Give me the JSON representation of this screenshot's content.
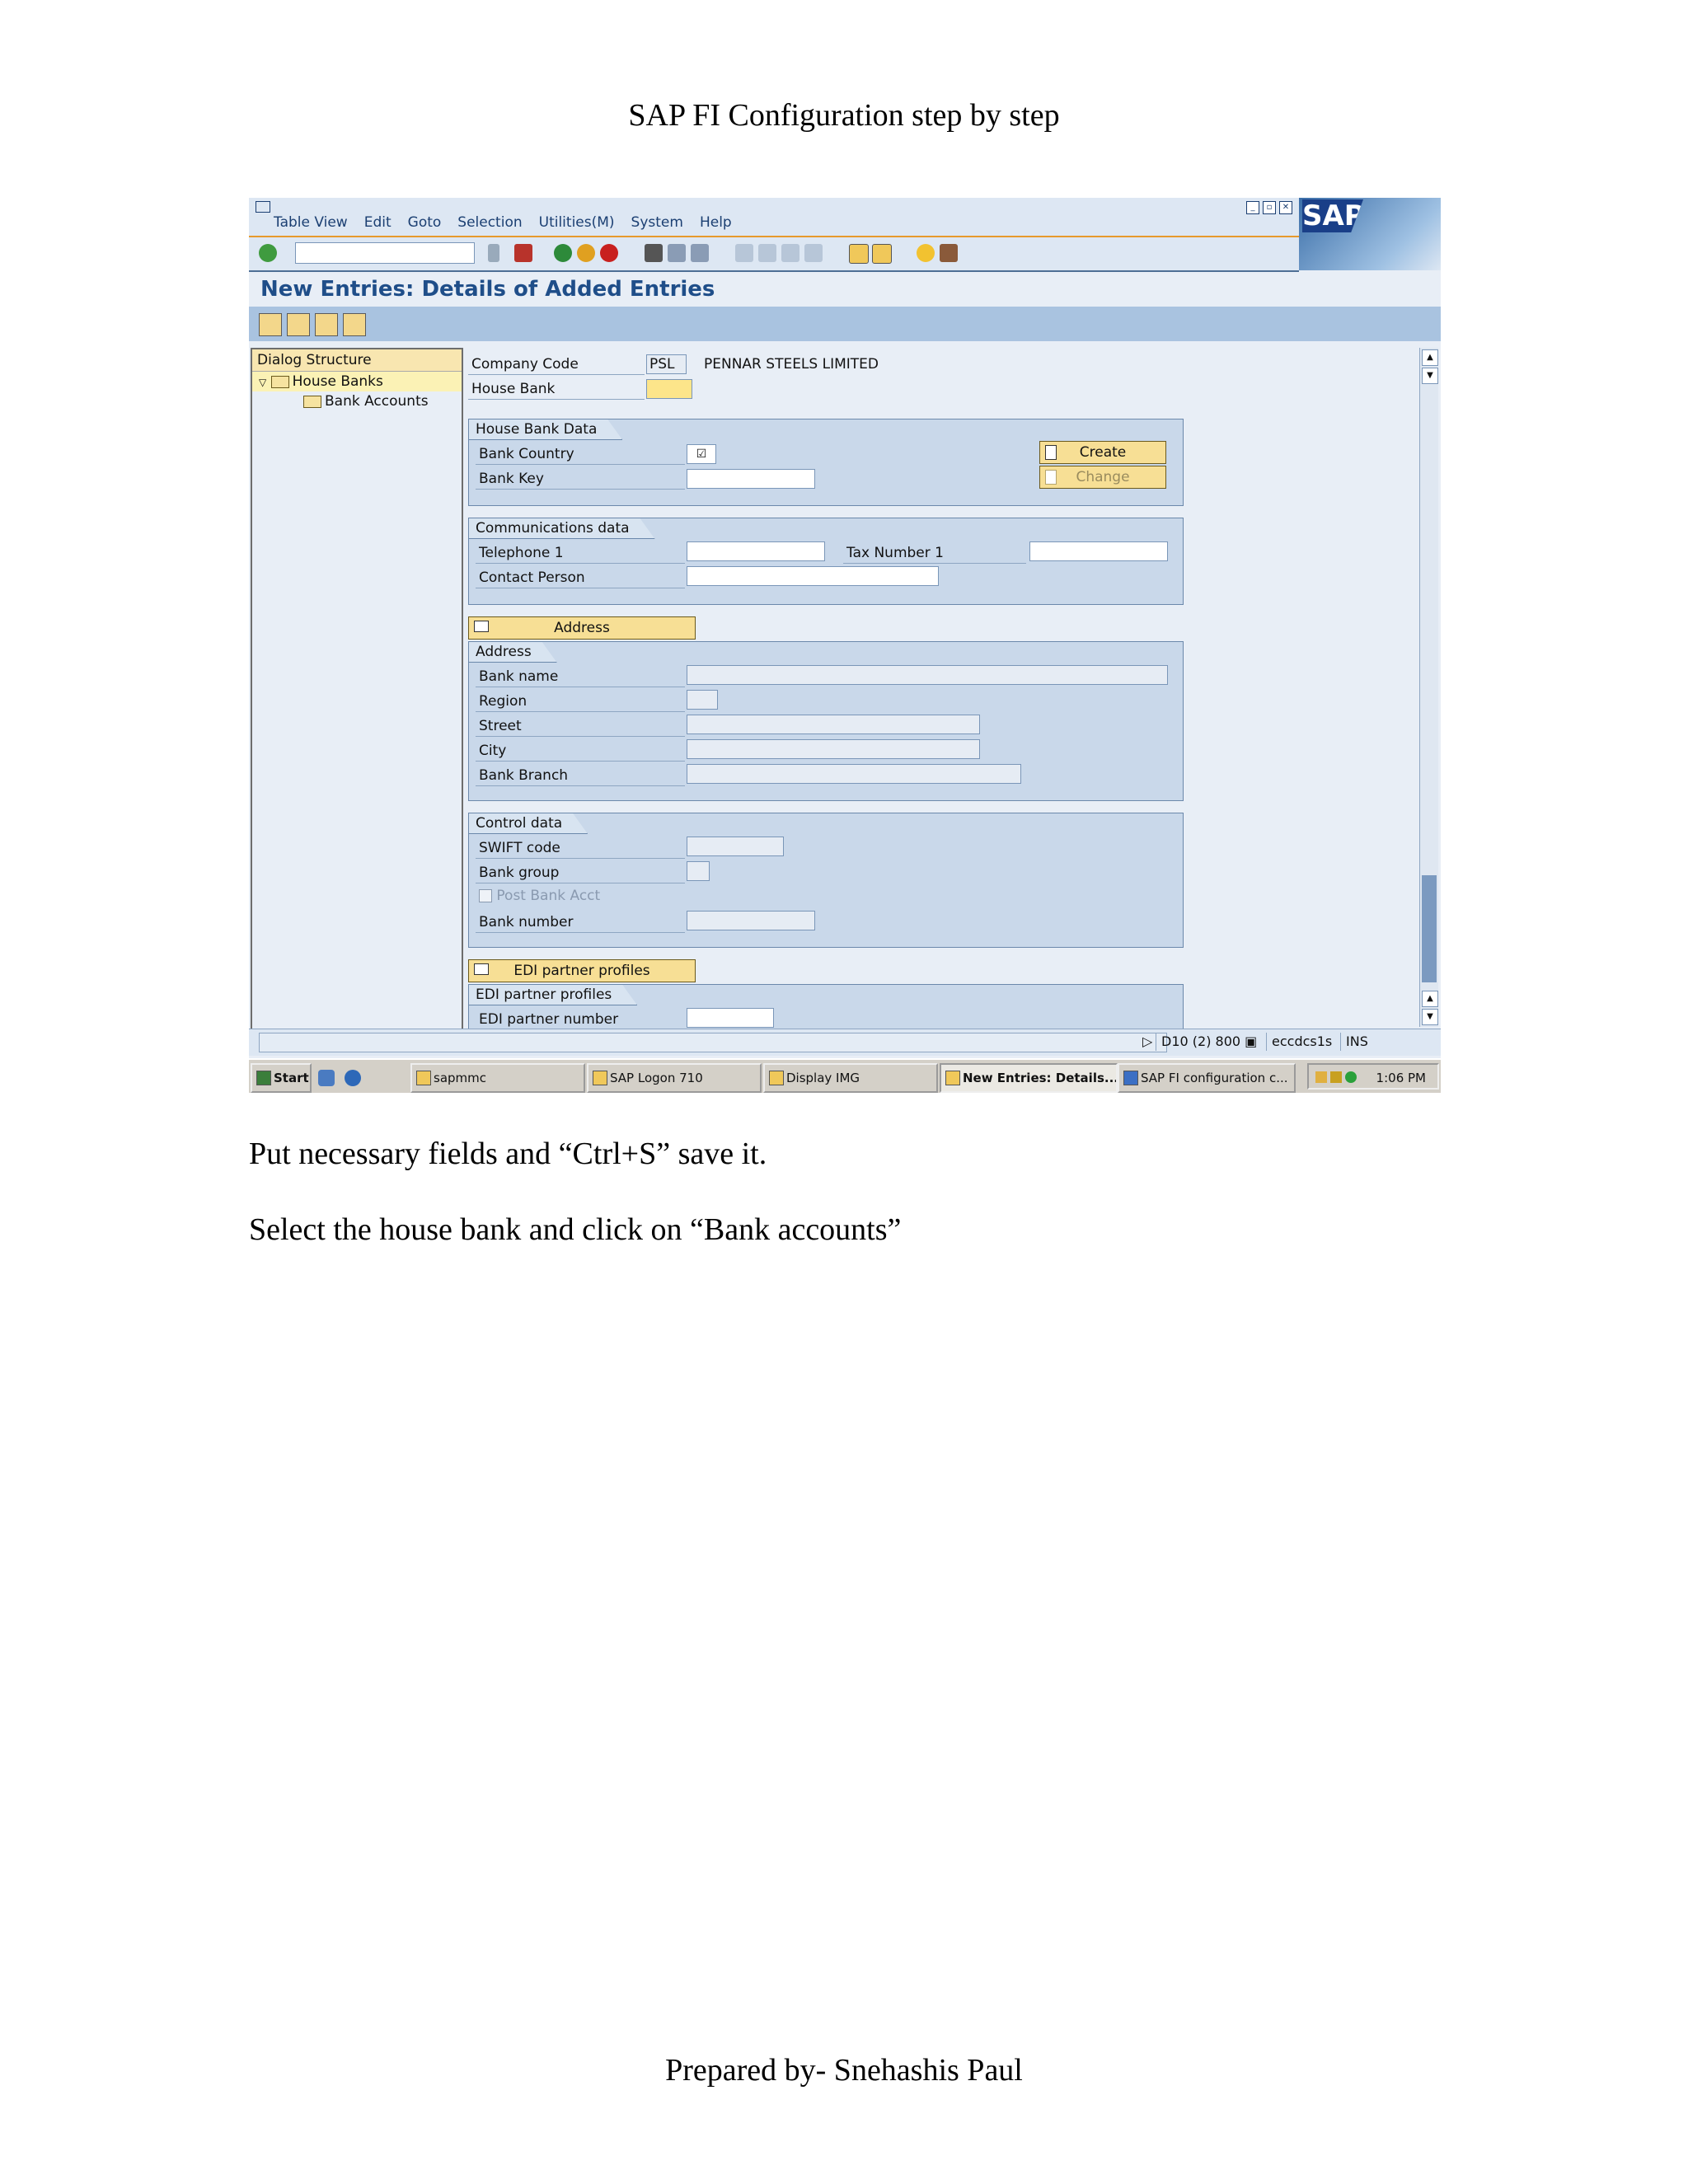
{
  "doc": {
    "title": "SAP FI Configuration step by step",
    "instruction_1": "Put necessary fields and “Ctrl+S” save it.",
    "instruction_2": "Select the house bank and click on “Bank accounts”",
    "footer": "Prepared by- Snehashis Paul"
  },
  "sap": {
    "menus": [
      "Table View",
      "Edit",
      "Goto",
      "Selection",
      "Utilities(M)",
      "System",
      "Help"
    ],
    "logo": "SAP",
    "screen_title": "New Entries: Details of Added Entries",
    "tree": {
      "header": "Dialog Structure",
      "items": [
        "House Banks",
        "Bank Accounts"
      ]
    },
    "header_fields": {
      "company_code_label": "Company Code",
      "company_code_value": "PSL",
      "company_name": "PENNAR STEELS LIMITED",
      "house_bank_label": "House Bank"
    },
    "house_bank_data": {
      "title": "House Bank Data",
      "bank_country_label": "Bank Country",
      "bank_key_label": "Bank Key",
      "create_label": "Create",
      "change_label": "Change"
    },
    "communications": {
      "title": "Communications data",
      "telephone_label": "Telephone 1",
      "tax_label": "Tax Number 1",
      "contact_label": "Contact Person"
    },
    "address_button": "Address",
    "address": {
      "title": "Address",
      "bank_name_label": "Bank name",
      "region_label": "Region",
      "street_label": "Street",
      "city_label": "City",
      "branch_label": "Bank Branch"
    },
    "control": {
      "title": "Control data",
      "swift_label": "SWIFT code",
      "bank_group_label": "Bank group",
      "post_bank_label": "Post Bank Acct",
      "bank_number_label": "Bank number"
    },
    "edi_button": "EDI partner profiles",
    "edi": {
      "title": "EDI partner profiles",
      "partner_number_label": "EDI partner number"
    },
    "status": {
      "system": "D10 (2) 800",
      "server": "eccdcs1s",
      "mode": "INS"
    }
  },
  "taskbar": {
    "start": "Start",
    "tasks": [
      "sapmmc",
      "SAP Logon 710",
      "Display IMG",
      "New Entries: Details...",
      "SAP FI configuration c..."
    ],
    "time": "1:06 PM"
  }
}
